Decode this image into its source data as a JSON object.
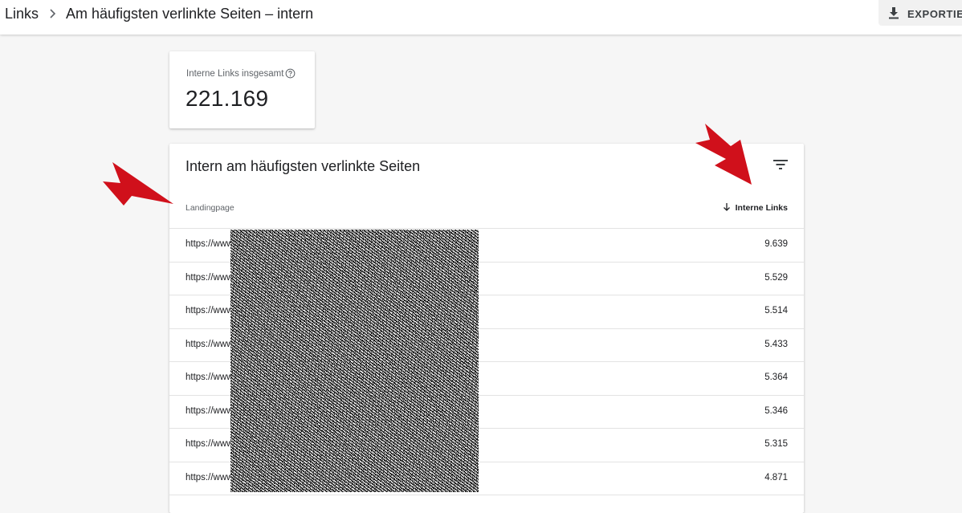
{
  "header": {
    "breadcrumb_root": "Links",
    "page_title": "Am häufigsten verlinkte Seiten – intern",
    "export_label": "EXPORTIERE"
  },
  "summary": {
    "label": "Interne Links insgesamt",
    "value": "221.169"
  },
  "table": {
    "title": "Intern am häufigsten verlinkte Seiten",
    "columns": {
      "landing": "Landingpage",
      "links": "Interne Links"
    },
    "rows": [
      {
        "url": "https://www",
        "value": "9.639"
      },
      {
        "url": "https://www",
        "value": "5.529"
      },
      {
        "url": "https://www",
        "value": "5.514"
      },
      {
        "url": "https://www",
        "value": "5.433"
      },
      {
        "url": "https://www",
        "value": "5.364"
      },
      {
        "url": "https://www",
        "value": "5.346"
      },
      {
        "url": "https://www",
        "value": "5.315"
      },
      {
        "url": "https://www",
        "value": "4.871"
      }
    ]
  },
  "colors": {
    "annotation_red": "#d0101b",
    "background": "#f6f6f6"
  },
  "icons": {
    "breadcrumb_separator": "chevron-right-icon",
    "export": "download-icon",
    "help": "help-circle-icon",
    "filter": "filter-icon",
    "sort": "arrow-down-icon"
  }
}
